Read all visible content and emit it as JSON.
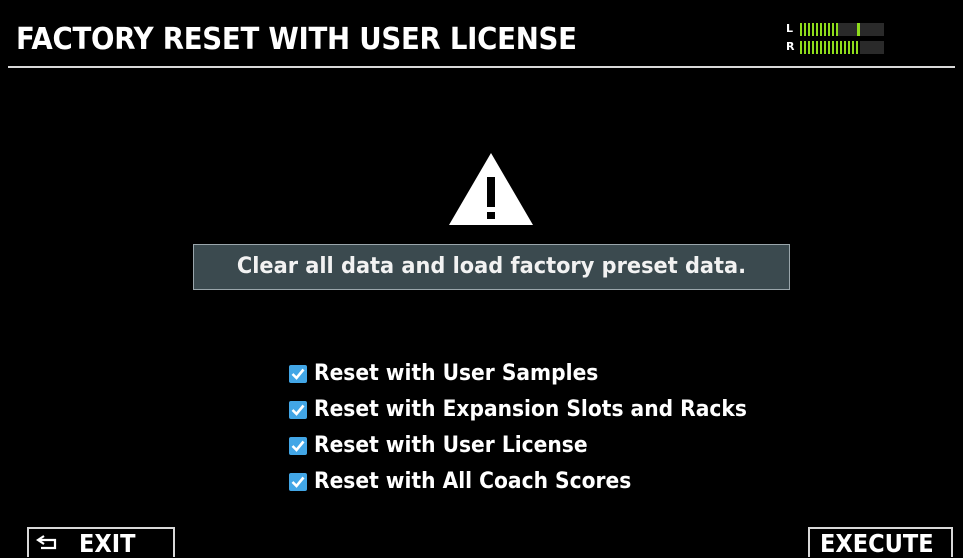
{
  "header": {
    "title": "FACTORY RESET WITH USER LICENSE",
    "level_meter": {
      "left_label": "L",
      "right_label": "R",
      "left_level": 0.45,
      "left_peak": 0.68,
      "right_level": 0.72
    }
  },
  "dialog": {
    "icon": "warning-triangle-icon",
    "message": "Clear all data and load factory preset data.",
    "options": [
      {
        "label": "Reset with User Samples",
        "checked": true
      },
      {
        "label": "Reset with Expansion Slots and Racks",
        "checked": true
      },
      {
        "label": "Reset with User License",
        "checked": true
      },
      {
        "label": "Reset with All Coach Scores",
        "checked": true
      }
    ]
  },
  "footer": {
    "exit_label": "EXIT",
    "exit_icon": "back-arrow-icon",
    "execute_label": "EXECUTE"
  },
  "colors": {
    "background": "#000000",
    "message_box": "#3b4a4f",
    "checkbox": "#42a6e6",
    "meter": "#8fdc1c"
  }
}
